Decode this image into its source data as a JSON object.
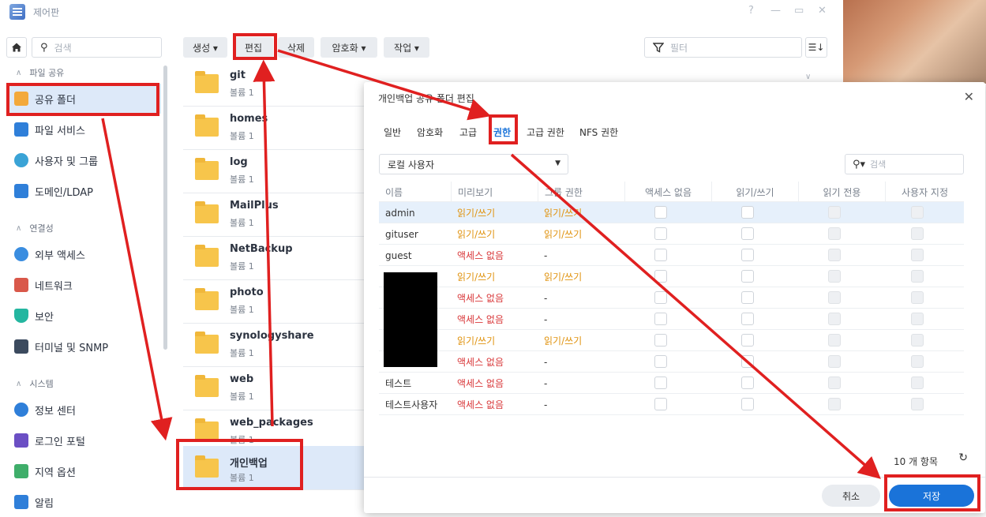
{
  "window": {
    "title": "제어판",
    "controls": [
      "?",
      "—",
      "▭",
      "✕"
    ]
  },
  "sidebar": {
    "search_placeholder": "검색",
    "sections": [
      {
        "label": "파일 공유"
      },
      {
        "label": "연결성"
      },
      {
        "label": "시스템"
      }
    ],
    "items": [
      {
        "label": "공유 폴더",
        "icon": "shared-folder-icon",
        "active": true
      },
      {
        "label": "파일 서비스",
        "icon": "file-services-icon"
      },
      {
        "label": "사용자 및 그룹",
        "icon": "users-groups-icon"
      },
      {
        "label": "도메인/LDAP",
        "icon": "domain-ldap-icon"
      },
      {
        "label": "외부 액세스",
        "icon": "external-access-icon"
      },
      {
        "label": "네트워크",
        "icon": "network-icon"
      },
      {
        "label": "보안",
        "icon": "shield-icon"
      },
      {
        "label": "터미널 및 SNMP",
        "icon": "terminal-icon"
      },
      {
        "label": "정보 센터",
        "icon": "info-icon"
      },
      {
        "label": "로그인 포털",
        "icon": "login-portal-icon"
      },
      {
        "label": "지역 옵션",
        "icon": "region-icon"
      },
      {
        "label": "알림",
        "icon": "notification-icon"
      }
    ]
  },
  "toolbar": {
    "create": "생성 ▾",
    "edit": "편집",
    "delete": "삭제",
    "encryption": "암호화 ▾",
    "action": "작업 ▾",
    "filter_placeholder": "필터"
  },
  "folders": [
    {
      "name": "git",
      "sub": "볼륨 1"
    },
    {
      "name": "homes",
      "sub": "볼륨 1"
    },
    {
      "name": "log",
      "sub": "볼륨 1"
    },
    {
      "name": "MailPlus",
      "sub": "볼륨 1"
    },
    {
      "name": "NetBackup",
      "sub": "볼륨 1"
    },
    {
      "name": "photo",
      "sub": "볼륨 1"
    },
    {
      "name": "synologyshare",
      "sub": "볼륨 1"
    },
    {
      "name": "web",
      "sub": "볼륨 1"
    },
    {
      "name": "web_packages",
      "sub": "볼륨 1"
    },
    {
      "name": "개인백업",
      "sub": "볼륨 1",
      "selected": true
    }
  ],
  "dialog": {
    "title": "개인백업 공유 폴더 편집",
    "tabs": [
      "일반",
      "암호화",
      "고급",
      "권한",
      "고급 권한",
      "NFS 권한"
    ],
    "active_tab": "권한",
    "user_scope": "로컬 사용자",
    "search_placeholder": "검색",
    "columns": [
      "이름",
      "미리보기",
      "그룹 권한",
      "액세스 없음",
      "읽기/쓰기",
      "읽기 전용",
      "사용자 지정"
    ],
    "rows": [
      {
        "name": "admin",
        "preview": "읽기/쓰기",
        "group": "읽기/쓰기",
        "selected": true
      },
      {
        "name": "gituser",
        "preview": "읽기/쓰기",
        "group": "읽기/쓰기"
      },
      {
        "name": "guest",
        "preview": "액세스 없음",
        "group": "-"
      },
      {
        "name": "",
        "preview": "읽기/쓰기",
        "group": "읽기/쓰기"
      },
      {
        "name": "",
        "preview": "액세스 없음",
        "group": "-"
      },
      {
        "name": "",
        "preview": "액세스 없음",
        "group": "-"
      },
      {
        "name": "",
        "preview": "읽기/쓰기",
        "group": "읽기/쓰기"
      },
      {
        "name": "",
        "preview": "액세스 없음",
        "group": "-"
      },
      {
        "name": "테스트",
        "preview": "액세스 없음",
        "group": "-"
      },
      {
        "name": "테스트사용자",
        "preview": "액세스 없음",
        "group": "-"
      }
    ],
    "count": "10 개 항목",
    "cancel": "취소",
    "save": "저장"
  },
  "colors": {
    "accent": "#1a73d9",
    "read_write": "#e0930f",
    "no_access": "#d9383a",
    "annotation": "#e02020"
  }
}
